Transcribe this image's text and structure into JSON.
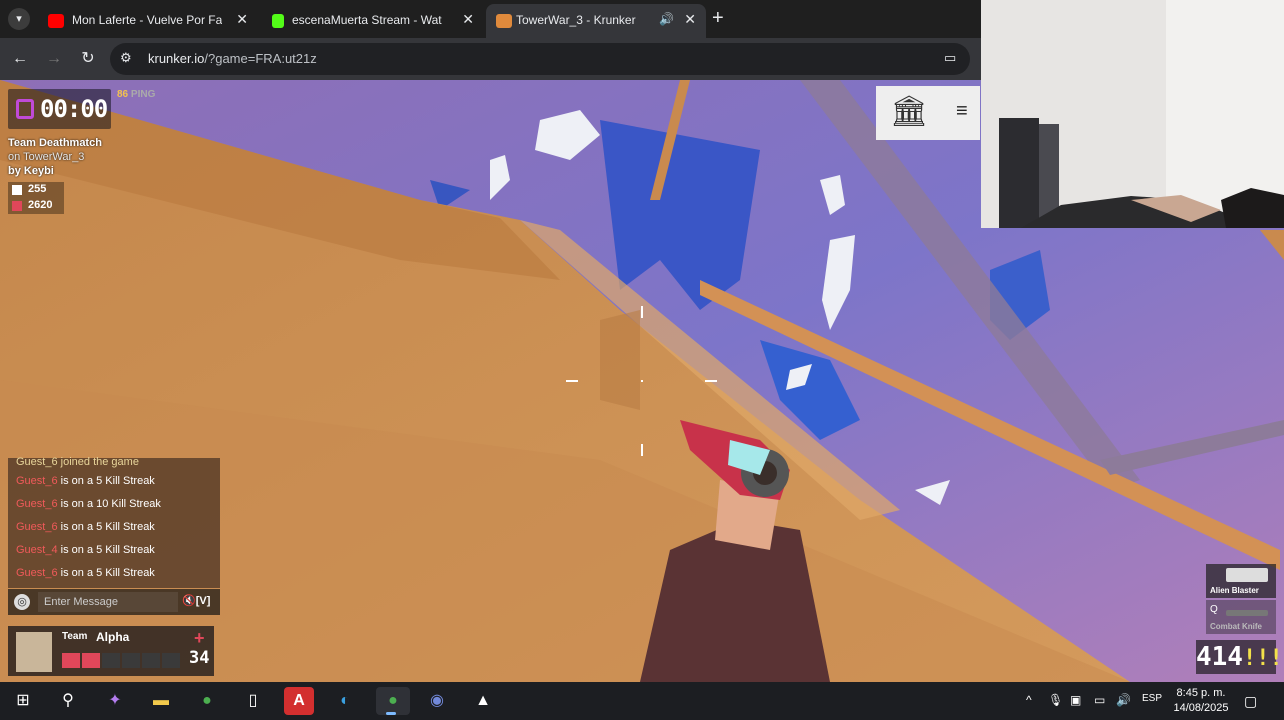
{
  "browser": {
    "tabs": [
      {
        "title": "Mon Laferte - Vuelve Por Favor",
        "icon": "youtube-icon",
        "color": "#ff0000",
        "active": false
      },
      {
        "title": "escenaMuerta Stream - Watch L",
        "icon": "kick-icon",
        "color": "#53fc18",
        "active": false
      },
      {
        "title": "TowerWar_3 - Krunker",
        "icon": "krunker-icon",
        "color": "#e08a3c",
        "active": true
      }
    ],
    "url_host": "krunker.io",
    "url_path": "/?game=FRA:ut21z"
  },
  "hud": {
    "timer": "00:00",
    "ping_value": "86",
    "ping_label": "PING",
    "mode": "Team Deathmatch",
    "map": "on TowerWar_3",
    "author": "by Keybi",
    "scores": [
      {
        "value": "255",
        "color": "#ffffff"
      },
      {
        "value": "2620",
        "color": "#e0475a"
      }
    ],
    "chat": [
      {
        "name": "Guest_6",
        "text": "joined the game",
        "system": true
      },
      {
        "name": "Guest_6",
        "text": "is on a 5 Kill Streak"
      },
      {
        "name": "Guest_6",
        "text": "is on a 10 Kill Streak"
      },
      {
        "name": "Guest_6",
        "text": "is on a 5 Kill Streak"
      },
      {
        "name": "Guest_4",
        "text": "is on a 5 Kill Streak"
      },
      {
        "name": "Guest_6",
        "text": "is on a 5 Kill Streak"
      }
    ],
    "chat_placeholder": "Enter Message",
    "chat_mute": "[V]",
    "team_label": "Team",
    "team_name": "Alpha",
    "health_value": "34",
    "health_segments": 6,
    "health_filled": 2,
    "weapon_primary": "Alien Blaster",
    "weapon_secondary": "Combat Knife",
    "weapon_secondary_key": "Q",
    "ammo": "4",
    "ammo_max": "14",
    "ammo_marks": "!!!"
  },
  "taskbar": {
    "lang": "ESP",
    "time": "8:45 p. m.",
    "date": "14/08/2025"
  }
}
